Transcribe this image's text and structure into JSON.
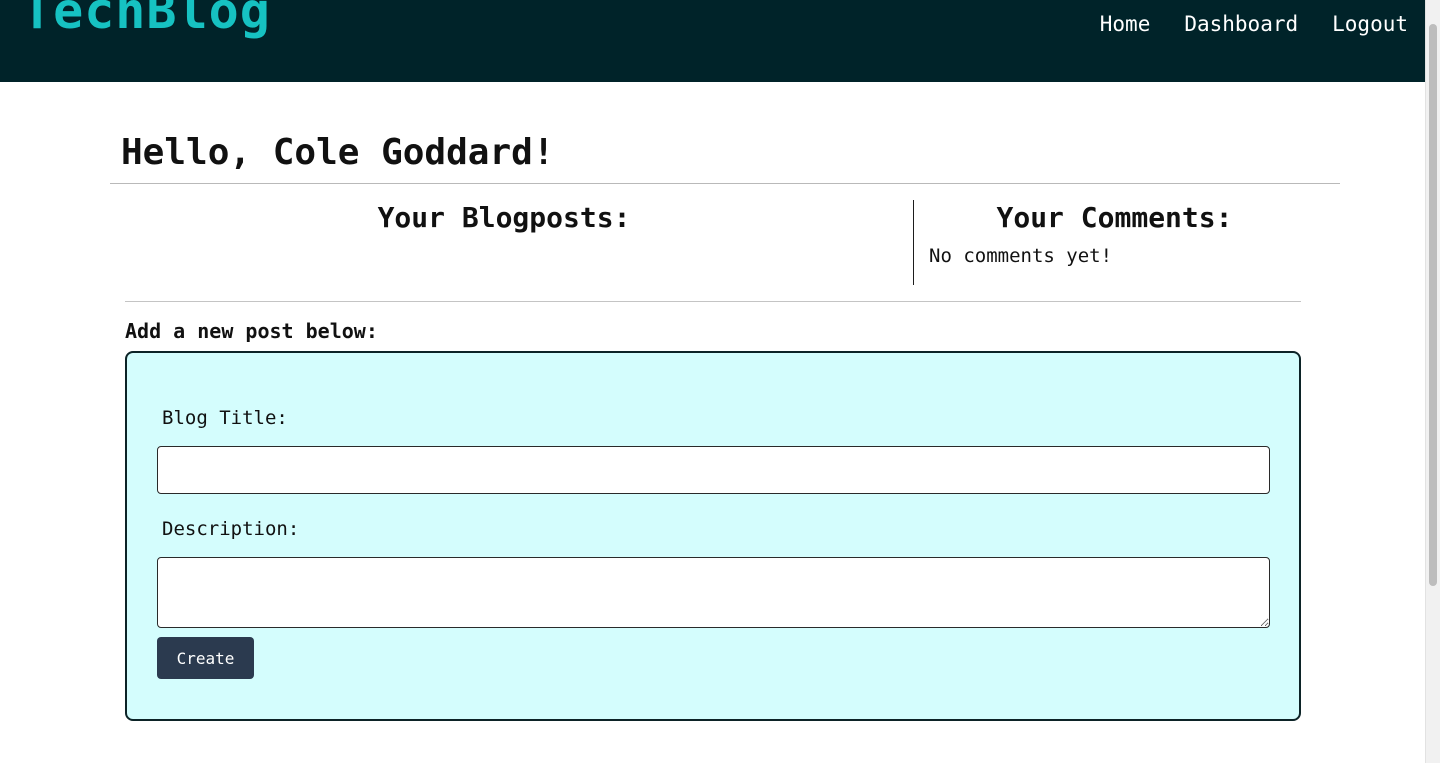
{
  "header": {
    "logo": "TechBlog",
    "nav": [
      "Home",
      "Dashboard",
      "Logout"
    ]
  },
  "greeting": "Hello, Cole Goddard!",
  "posts_section": {
    "title": "Your Blogposts:"
  },
  "comments_section": {
    "title": "Your Comments:",
    "empty_text": "No comments yet!"
  },
  "new_post": {
    "prompt": "Add a new post below:",
    "title_label": "Blog Title:",
    "title_value": "",
    "description_label": "Description:",
    "description_value": "",
    "submit_label": "Create"
  },
  "colors": {
    "header_bg": "#002329",
    "logo": "#16c2c2",
    "form_bg": "#d4fdfd",
    "button_bg": "#2b3a4f"
  }
}
